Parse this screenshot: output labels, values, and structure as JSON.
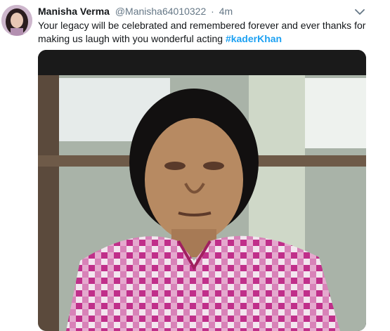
{
  "tweet": {
    "author_name": "Manisha Verma",
    "handle": "@Manisha64010322",
    "separator": "·",
    "time": "4m",
    "text_main": "Your legacy will be celebrated and remembered forever and ever thanks for making us laugh with you wonderful acting",
    "hashtag": "#kaderKhan"
  },
  "icons": {
    "avatar": "avatar",
    "caret": "chevron-down-icon"
  },
  "colors": {
    "link": "#1da1f2",
    "secondary_text": "#657786",
    "primary_text": "#14171a"
  }
}
